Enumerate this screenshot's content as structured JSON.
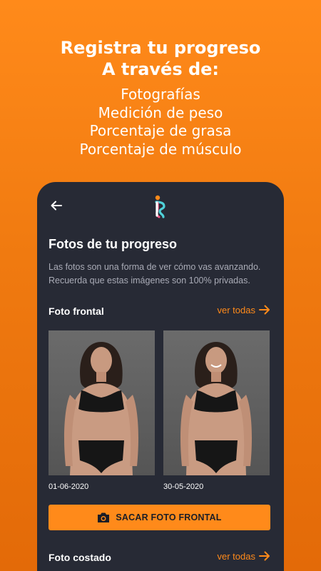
{
  "promo": {
    "headline_line1": "Registra tu progreso",
    "headline_line2": "A través de:",
    "features": [
      "Fotografías",
      "Medición de peso",
      "Porcentaje de grasa",
      "Porcentaje de músculo"
    ]
  },
  "colors": {
    "background": "#f07a10",
    "accent": "#ff8a1a",
    "phone_surface": "#272a35",
    "muted_text": "#a9abb6",
    "logo_teal": "#4fd1d9",
    "logo_pink": "#ff5a8a"
  },
  "topbar": {
    "back_icon": "arrow-left-icon",
    "logo_icon": "app-logo-icon"
  },
  "page": {
    "title": "Fotos de tu progreso",
    "description": "Las fotos son una forma de ver cómo vas avanzando. Recuerda que estas imágenes son 100% privadas."
  },
  "front": {
    "label": "Foto frontal",
    "see_all": "ver todas",
    "photos": [
      {
        "date": "01-06-2020"
      },
      {
        "date": "30-05-2020"
      }
    ],
    "button_label": "SACAR FOTO FRONTAL",
    "button_icon": "camera-icon"
  },
  "side": {
    "label": "Foto costado",
    "see_all": "ver todas"
  }
}
